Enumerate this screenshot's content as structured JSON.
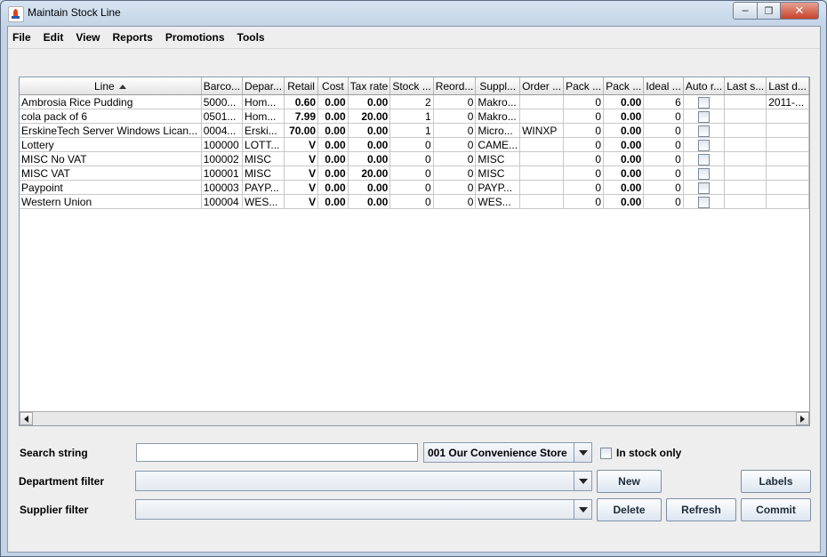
{
  "window": {
    "title": "Maintain Stock Line"
  },
  "menubar": {
    "items": [
      "File",
      "Edit",
      "View",
      "Reports",
      "Promotions",
      "Tools"
    ]
  },
  "table": {
    "headers": [
      "Line",
      "Barco...",
      "Depar...",
      "Retail",
      "Cost",
      "Tax rate",
      "Stock ...",
      "Reord...",
      "Suppl...",
      "Order ...",
      "Pack ...",
      "Pack ...",
      "Ideal ...",
      "Auto r...",
      "Last s...",
      "Last d..."
    ],
    "sort_column": "Line",
    "rows": [
      [
        "Ambrosia Rice Pudding",
        "5000...",
        "Hom...",
        "0.60",
        "0.00",
        "0.00",
        "2",
        "0",
        "Makro...",
        "",
        "0",
        "0.00",
        "6",
        "",
        "",
        "2011-..."
      ],
      [
        "cola pack of 6",
        "0501...",
        "Hom...",
        "7.99",
        "0.00",
        "20.00",
        "1",
        "0",
        "Makro...",
        "",
        "0",
        "0.00",
        "0",
        "",
        "",
        ""
      ],
      [
        "ErskineTech Server Windows Lican...",
        "0004...",
        "Erski...",
        "70.00",
        "0.00",
        "0.00",
        "1",
        "0",
        "Micro...",
        "WINXP",
        "0",
        "0.00",
        "0",
        "",
        "",
        ""
      ],
      [
        "Lottery",
        "100000",
        "LOTT...",
        "V",
        "0.00",
        "0.00",
        "0",
        "0",
        "CAME...",
        "",
        "0",
        "0.00",
        "0",
        "",
        "",
        ""
      ],
      [
        "MISC No VAT",
        "100002",
        "MISC",
        "V",
        "0.00",
        "0.00",
        "0",
        "0",
        "MISC",
        "",
        "0",
        "0.00",
        "0",
        "",
        "",
        ""
      ],
      [
        "MISC VAT",
        "100001",
        "MISC",
        "V",
        "0.00",
        "20.00",
        "0",
        "0",
        "MISC",
        "",
        "0",
        "0.00",
        "0",
        "",
        "",
        ""
      ],
      [
        "Paypoint",
        "100003",
        "PAYP...",
        "V",
        "0.00",
        "0.00",
        "0",
        "0",
        "PAYP...",
        "",
        "0",
        "0.00",
        "0",
        "",
        "",
        ""
      ],
      [
        "Western Union",
        "100004",
        "WES...",
        "V",
        "0.00",
        "0.00",
        "0",
        "0",
        "WES...",
        "",
        "0",
        "0.00",
        "0",
        "",
        "",
        ""
      ]
    ]
  },
  "form": {
    "search_label": "Search string",
    "search_value": "",
    "store_value": "001 Our Convenience Store",
    "in_stock_label": "In stock only",
    "in_stock_checked": false,
    "department_label": "Department filter",
    "department_value": "",
    "supplier_label": "Supplier filter",
    "supplier_value": ""
  },
  "buttons": {
    "new": "New",
    "labels": "Labels",
    "delete": "Delete",
    "refresh": "Refresh",
    "commit": "Commit"
  }
}
